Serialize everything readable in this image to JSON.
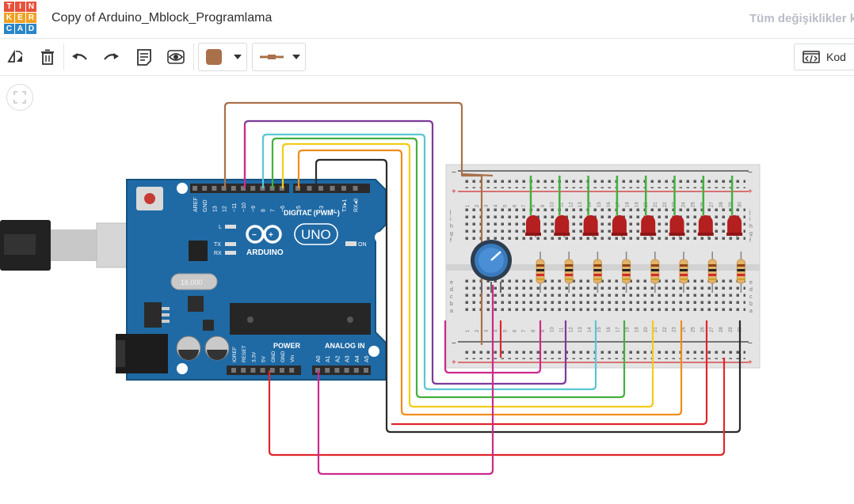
{
  "app": {
    "logo_letters": [
      "T",
      "I",
      "N",
      "K",
      "E",
      "R",
      "C",
      "A",
      "D"
    ],
    "logo_colors": [
      "#e8513b",
      "#e8513b",
      "#e8513b",
      "#f0a123",
      "#f0a123",
      "#f0a123",
      "#2a86c7",
      "#2a86c7",
      "#2a86c7"
    ],
    "title": "Copy of Arduino_Mblock_Programlama",
    "save_status": "Tüm değişiklikler k"
  },
  "toolbar": {
    "rotate_icon": "rotate-icon",
    "delete_icon": "trash-icon",
    "undo_icon": "undo-icon",
    "redo_icon": "redo-icon",
    "notes_icon": "notes-icon",
    "visibility_icon": "eye-icon",
    "wire_color": "#a9714a",
    "wire_type_icon": "wire-type-icon",
    "code_label": "Kod"
  },
  "canvas": {
    "fit_icon": "fit-view-icon",
    "arduino": {
      "brand": "ARDUINO",
      "model": "UNO",
      "digital_label": "DIGITAL (PWM~)",
      "power_label": "POWER",
      "analog_label": "ANALOG IN",
      "on_label": "ON",
      "l_label": "L",
      "tx_label": "TX",
      "rx_label": "RX",
      "crystal_label": "16.000",
      "top_pins": [
        "AREF",
        "GND",
        "13",
        "12",
        "~11",
        "~10",
        "~9",
        "8",
        "7",
        "~6",
        "~5",
        "4",
        "~3",
        "2",
        "TX▸1",
        "RX◂0"
      ],
      "power_pins": [
        "IOREF",
        "RESET",
        "3.3V",
        "5V",
        "GND",
        "GND",
        "Vin"
      ],
      "analog_pins": [
        "A0",
        "A1",
        "A2",
        "A3",
        "A4",
        "A5"
      ]
    },
    "breadboard": {
      "row_letters_top": [
        "j",
        "i",
        "h",
        "g",
        "f"
      ],
      "row_letters_bottom": [
        "e",
        "d",
        "c",
        "b",
        "a"
      ],
      "column_numbers": [
        "1",
        "2",
        "3",
        "4",
        "5",
        "6",
        "7",
        "8",
        "9",
        "10",
        "11",
        "12",
        "13",
        "14",
        "15",
        "16",
        "17",
        "18",
        "19",
        "20",
        "21",
        "22",
        "23",
        "24",
        "25",
        "26",
        "27",
        "28",
        "29",
        "30"
      ],
      "rail_minus": "−",
      "rail_plus": "+"
    },
    "led_count": 8,
    "led_color": "#b41f1f",
    "wire_colors": {
      "brown": "#a9714a",
      "magenta": "#cc2a8c",
      "purple": "#7d3b9c",
      "cyan": "#5bc6d3",
      "green": "#43b03e",
      "yellow": "#f2cc17",
      "orange": "#f08d1a",
      "black": "#2b2b2b",
      "red": "#e0262b"
    }
  }
}
